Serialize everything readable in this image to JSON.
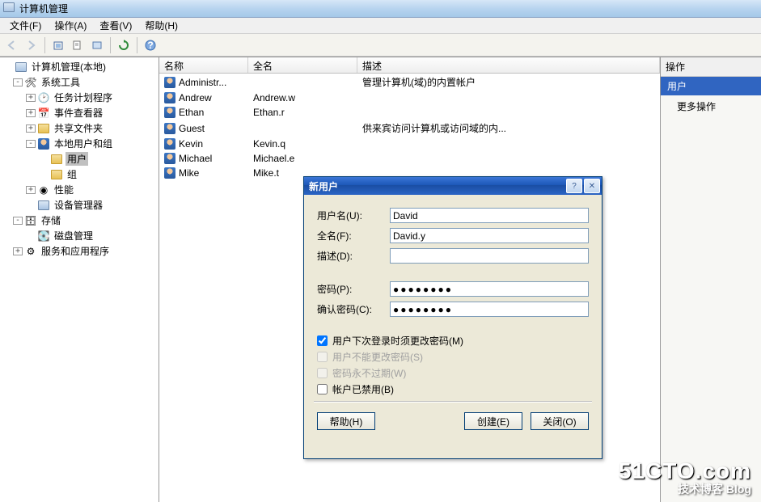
{
  "window": {
    "title": "计算机管理"
  },
  "menu": {
    "file": "文件(F)",
    "action": "操作(A)",
    "view": "查看(V)",
    "help": "帮助(H)"
  },
  "tree": {
    "root": "计算机管理(本地)",
    "systools": "系统工具",
    "task_sched": "任务计划程序",
    "event_viewer": "事件查看器",
    "shared_folders": "共享文件夹",
    "local_users": "本地用户和组",
    "users": "用户",
    "groups": "组",
    "perf": "性能",
    "devmgr": "设备管理器",
    "storage": "存储",
    "diskmgr": "磁盘管理",
    "services_apps": "服务和应用程序"
  },
  "list": {
    "headers": {
      "name": "名称",
      "fullname": "全名",
      "desc": "描述"
    },
    "rows": [
      {
        "name": "Administr...",
        "fullname": "",
        "desc": "管理计算机(域)的内置帐户"
      },
      {
        "name": "Andrew",
        "fullname": "Andrew.w",
        "desc": ""
      },
      {
        "name": "Ethan",
        "fullname": "Ethan.r",
        "desc": ""
      },
      {
        "name": "Guest",
        "fullname": "",
        "desc": "供来宾访问计算机或访问域的内..."
      },
      {
        "name": "Kevin",
        "fullname": "Kevin.q",
        "desc": ""
      },
      {
        "name": "Michael",
        "fullname": "Michael.e",
        "desc": ""
      },
      {
        "name": "Mike",
        "fullname": "Mike.t",
        "desc": ""
      }
    ]
  },
  "actions": {
    "header": "操作",
    "selection": "用户",
    "more": "更多操作"
  },
  "dialog": {
    "title": "新用户",
    "username_label": "用户名(U):",
    "username_value": "David",
    "fullname_label": "全名(F):",
    "fullname_value": "David.y",
    "desc_label": "描述(D):",
    "desc_value": "",
    "password_label": "密码(P):",
    "password_value": "●●●●●●●●",
    "confirm_label": "确认密码(C):",
    "confirm_value": "●●●●●●●●",
    "chk_must_change": "用户下次登录时须更改密码(M)",
    "chk_cannot_change": "用户不能更改密码(S)",
    "chk_never_expire": "密码永不过期(W)",
    "chk_disabled": "帐户已禁用(B)",
    "btn_help": "帮助(H)",
    "btn_create": "创建(E)",
    "btn_close": "关闭(O)"
  },
  "watermark": {
    "main": "51CTO.com",
    "sub": "技术博客  Blog"
  }
}
